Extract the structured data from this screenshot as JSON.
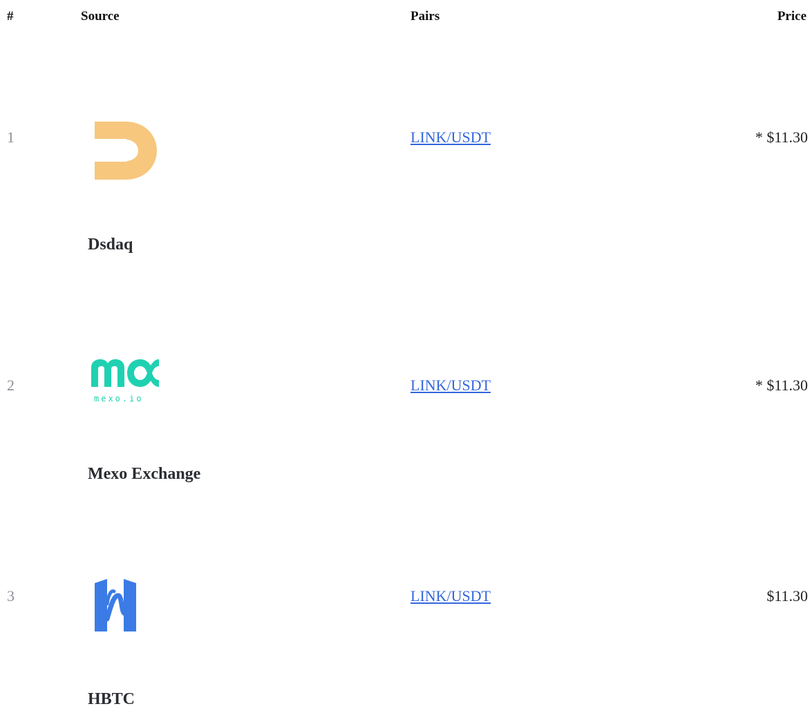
{
  "table": {
    "headers": {
      "num": "#",
      "source": "Source",
      "pairs": "Pairs",
      "price": "Price"
    },
    "rows": [
      {
        "num": "1",
        "exchange": "Dsdaq",
        "logo_icon": "dsdaq-logo-icon",
        "pair": "LINK/USDT",
        "price": "* $11.30"
      },
      {
        "num": "2",
        "exchange": "Mexo Exchange",
        "logo_icon": "mexo-logo-icon",
        "logo_text": "mexo.io",
        "pair": "LINK/USDT",
        "price": "* $11.30"
      },
      {
        "num": "3",
        "exchange": "HBTC",
        "logo_icon": "hbtc-logo-icon",
        "pair": "LINK/USDT",
        "price": "$11.30"
      }
    ]
  },
  "colors": {
    "link": "#3366dd",
    "dsdaq_logo": "#f7c77e",
    "mexo_logo": "#1fd1b1",
    "hbtc_logo": "#3a7be6",
    "row_number": "#8a8f96"
  }
}
